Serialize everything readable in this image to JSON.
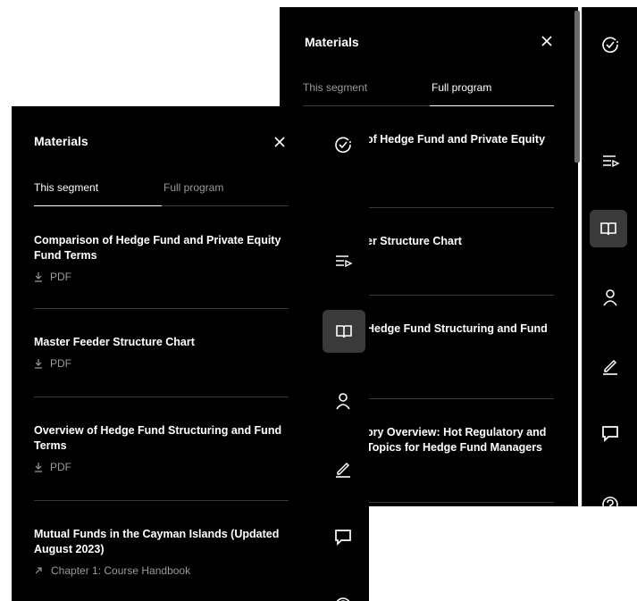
{
  "back_panel": {
    "title": "Materials",
    "tabs": [
      {
        "label": "This segment",
        "active": false
      },
      {
        "label": "Full program",
        "active": true
      }
    ],
    "items": [
      {
        "title_lines": [
          "of Hedge Fund and Private Equity"
        ]
      },
      {
        "title_lines": [
          "er Structure Chart"
        ]
      },
      {
        "title_lines": [
          "Hedge Fund Structuring and Fund"
        ]
      },
      {
        "title_lines": [
          "ory Overview: Hot Regulatory and",
          "Topics for Hedge Fund Managers"
        ]
      }
    ]
  },
  "front_panel": {
    "title": "Materials",
    "tabs": [
      {
        "label": "This segment",
        "active": true
      },
      {
        "label": "Full program",
        "active": false
      }
    ],
    "items": [
      {
        "title_lines": [
          "Comparison of Hedge Fund and Private Equity",
          "Fund Terms"
        ],
        "sub": "PDF",
        "sub_icon": "download-icon"
      },
      {
        "title_lines": [
          "Master Feeder Structure Chart"
        ],
        "sub": "PDF",
        "sub_icon": "download-icon"
      },
      {
        "title_lines": [
          "Overview of Hedge Fund Structuring and Fund",
          "Terms"
        ],
        "sub": "PDF",
        "sub_icon": "download-icon"
      },
      {
        "title_lines": [
          "Mutual Funds in the Cayman Islands (Updated",
          "August 2023)"
        ],
        "sub": "Chapter 1: Course Handbook",
        "sub_icon": "arrow-up-right-icon"
      }
    ]
  },
  "rail_icons": [
    "progress-icon",
    "playlist-icon",
    "book-icon",
    "person-icon",
    "pencil-icon",
    "comment-icon",
    "help-icon"
  ],
  "rail_active": "book-icon",
  "colors": {
    "background": "#000000",
    "active_rail": "#3a3a3a",
    "muted_text": "#9a9a9a",
    "divider": "#3a3a3a"
  }
}
